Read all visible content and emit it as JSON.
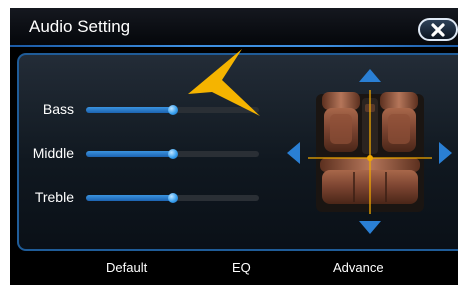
{
  "title": "Audio Setting",
  "close": {
    "icon": "close-icon"
  },
  "sliders": [
    {
      "label": "Bass",
      "value_fraction": 0.5
    },
    {
      "label": "Middle",
      "value_fraction": 0.5
    },
    {
      "label": "Treble",
      "value_fraction": 0.5
    }
  ],
  "balance_fader": {
    "icons": [
      "arrow-up-icon",
      "arrow-down-icon",
      "arrow-left-icon",
      "arrow-right-icon",
      "car-seats-icon"
    ],
    "position": "center"
  },
  "tabs": [
    {
      "label": "Default"
    },
    {
      "label": "EQ"
    },
    {
      "label": "Advance"
    }
  ],
  "colors": {
    "accent": "#2a7fd4",
    "pointer": "#f5b400",
    "background": "#000000"
  }
}
